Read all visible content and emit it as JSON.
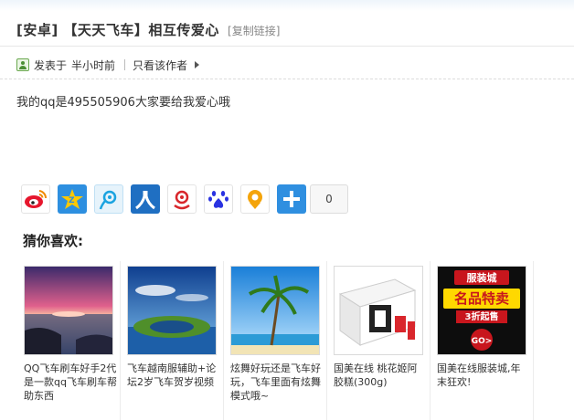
{
  "post": {
    "title": "[安卓] 【天天飞车】相互传爱心",
    "copy_link": "[复制链接]",
    "posted_label": "发表于",
    "posted_time": "半小时前",
    "only_author": "只看该作者",
    "content": "我的qq是495505906大家要给我爱心哦"
  },
  "share": {
    "buttons": [
      {
        "name": "sina-weibo",
        "icon": "weibo-icon"
      },
      {
        "name": "qzone",
        "icon": "qzone-icon"
      },
      {
        "name": "tencent-weibo",
        "icon": "tencent-weibo-icon"
      },
      {
        "name": "renren",
        "icon": "renren-icon"
      },
      {
        "name": "kaixin",
        "icon": "kaixin-icon"
      },
      {
        "name": "baidu",
        "icon": "baidu-icon"
      },
      {
        "name": "favorite",
        "icon": "location-icon"
      },
      {
        "name": "more",
        "icon": "plus-icon"
      }
    ],
    "count": "0"
  },
  "recommend": {
    "title": "猜你喜欢:",
    "items": [
      {
        "caption": "QQ飞车刷车好手2代是一款qq飞车刷车帮助东西",
        "thumb": "sunset-sea"
      },
      {
        "caption": "飞车越南服辅助+论坛2岁飞车贺岁视频",
        "thumb": "island-lake"
      },
      {
        "caption": "炫舞好玩还是飞车好玩，飞车里面有炫舞模式哦~",
        "thumb": "palm-beach"
      },
      {
        "caption": "国美在线 桃花姬阿胶糕(300g)",
        "thumb": "product-box"
      },
      {
        "caption": "国美在线服装城,年末狂欢!",
        "thumb": "promo-banner"
      }
    ],
    "promo_text_1": "服装城",
    "promo_text_2": "名品特卖",
    "promo_text_3": "3折起售",
    "promo_go": "GO>"
  },
  "colors": {
    "accent_blue": "#2d8fe0",
    "promo_red": "#c8161d",
    "promo_yellow": "#ffd800"
  }
}
